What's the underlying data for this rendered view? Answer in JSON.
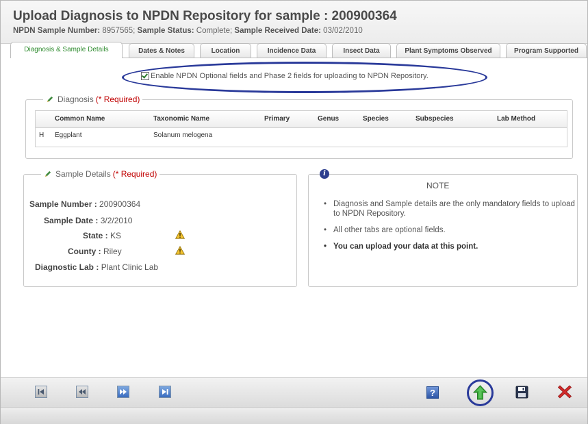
{
  "window": {
    "title": "Upload Diagnosis to NPDN Repository for sample : 200900364",
    "subtitle_parts": [
      {
        "label": "NPDN Sample Number:",
        "value": " 8957565; "
      },
      {
        "label": "Sample Status:",
        "value": " Complete; "
      },
      {
        "label": "Sample Received Date:",
        "value": " 03/02/2010"
      }
    ]
  },
  "tabs": [
    {
      "label": "Diagnosis & Sample Details",
      "active": true
    },
    {
      "label": "Dates & Notes"
    },
    {
      "label": "Location"
    },
    {
      "label": "Incidence Data"
    },
    {
      "label": "Insect Data"
    },
    {
      "label": "Plant Symptoms Observed"
    },
    {
      "label": "Program Supported"
    }
  ],
  "enable_option": {
    "label": "Enable NPDN Optional fields and Phase 2 fields for uploading to NPDN Repository.",
    "checked": true
  },
  "diagnosis": {
    "legend": "Diagnosis",
    "required": "(* Required)",
    "columns": [
      "Common Name",
      "Taxonomic Name",
      "Primary",
      "Genus",
      "Species",
      "Subspecies",
      "Lab Method"
    ],
    "rows": [
      {
        "marker": "H",
        "common_name": "Eggplant",
        "taxonomic_name": "Solanum melogena"
      }
    ]
  },
  "sample_details": {
    "legend": "Sample Details",
    "required": "(* Required)",
    "fields": [
      {
        "label": "Sample Number :",
        "value": "200900364"
      },
      {
        "label": "Sample Date :",
        "value": "3/2/2010"
      },
      {
        "label": "State :",
        "value": "KS",
        "warning": true
      },
      {
        "label": "County :",
        "value": "Riley",
        "warning": true
      },
      {
        "label": "Diagnostic Lab :",
        "value": "Plant Clinic Lab"
      }
    ]
  },
  "note": {
    "title": "NOTE",
    "items": [
      {
        "text": "Diagnosis and Sample details are the only mandatory fields to upload to NPDN Repository."
      },
      {
        "text": "All other tabs are optional fields."
      },
      {
        "text": "You can upload your data at this point.",
        "bold": true
      }
    ]
  },
  "toolbar": {
    "icons": [
      "first-record-icon",
      "previous-record-icon",
      "next-record-icon",
      "last-record-icon",
      "help-icon",
      "upload-arrow-icon",
      "save-disk-icon",
      "close-x-icon"
    ],
    "help_glyph": "?"
  },
  "colors": {
    "required": "#c00000",
    "active_tab": "#2e8b2e",
    "highlight": "#2a3a9a",
    "upload": "#3caa3c",
    "close": "#d12a2a"
  }
}
